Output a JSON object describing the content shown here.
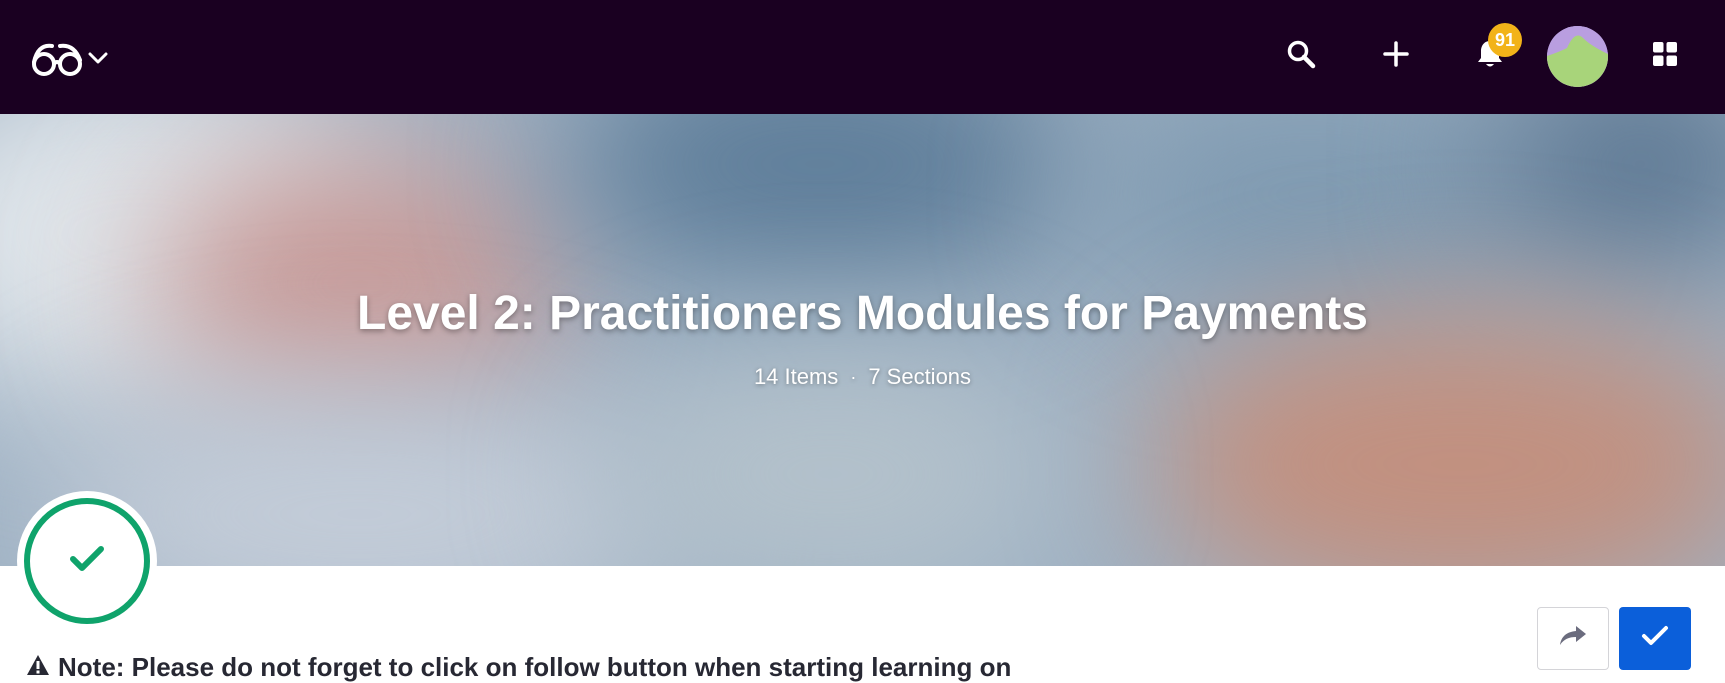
{
  "header": {
    "logo_icon": "glasses-icon",
    "dropdown_icon": "chevron-down-icon",
    "search_icon": "search-icon",
    "add_icon": "plus-icon",
    "notifications_icon": "bell-icon",
    "notifications_count": "91",
    "apps_icon": "grid-icon",
    "background_color": "#1a0021",
    "badge_color": "#f2b319"
  },
  "hero": {
    "title": "Level 2: Practitioners Modules for Payments",
    "items_count": "14 Items",
    "separator": "·",
    "sections_count": "7 Sections"
  },
  "status": {
    "icon": "check-icon",
    "state": "completed",
    "color": "#0fa36b"
  },
  "actions": {
    "share_icon": "share-arrow-icon",
    "follow_icon": "check-icon",
    "follow_color": "#0b5fda"
  },
  "note": {
    "icon": "warning-icon",
    "text": "Note: Please do not forget to click on follow button when starting learning on"
  }
}
